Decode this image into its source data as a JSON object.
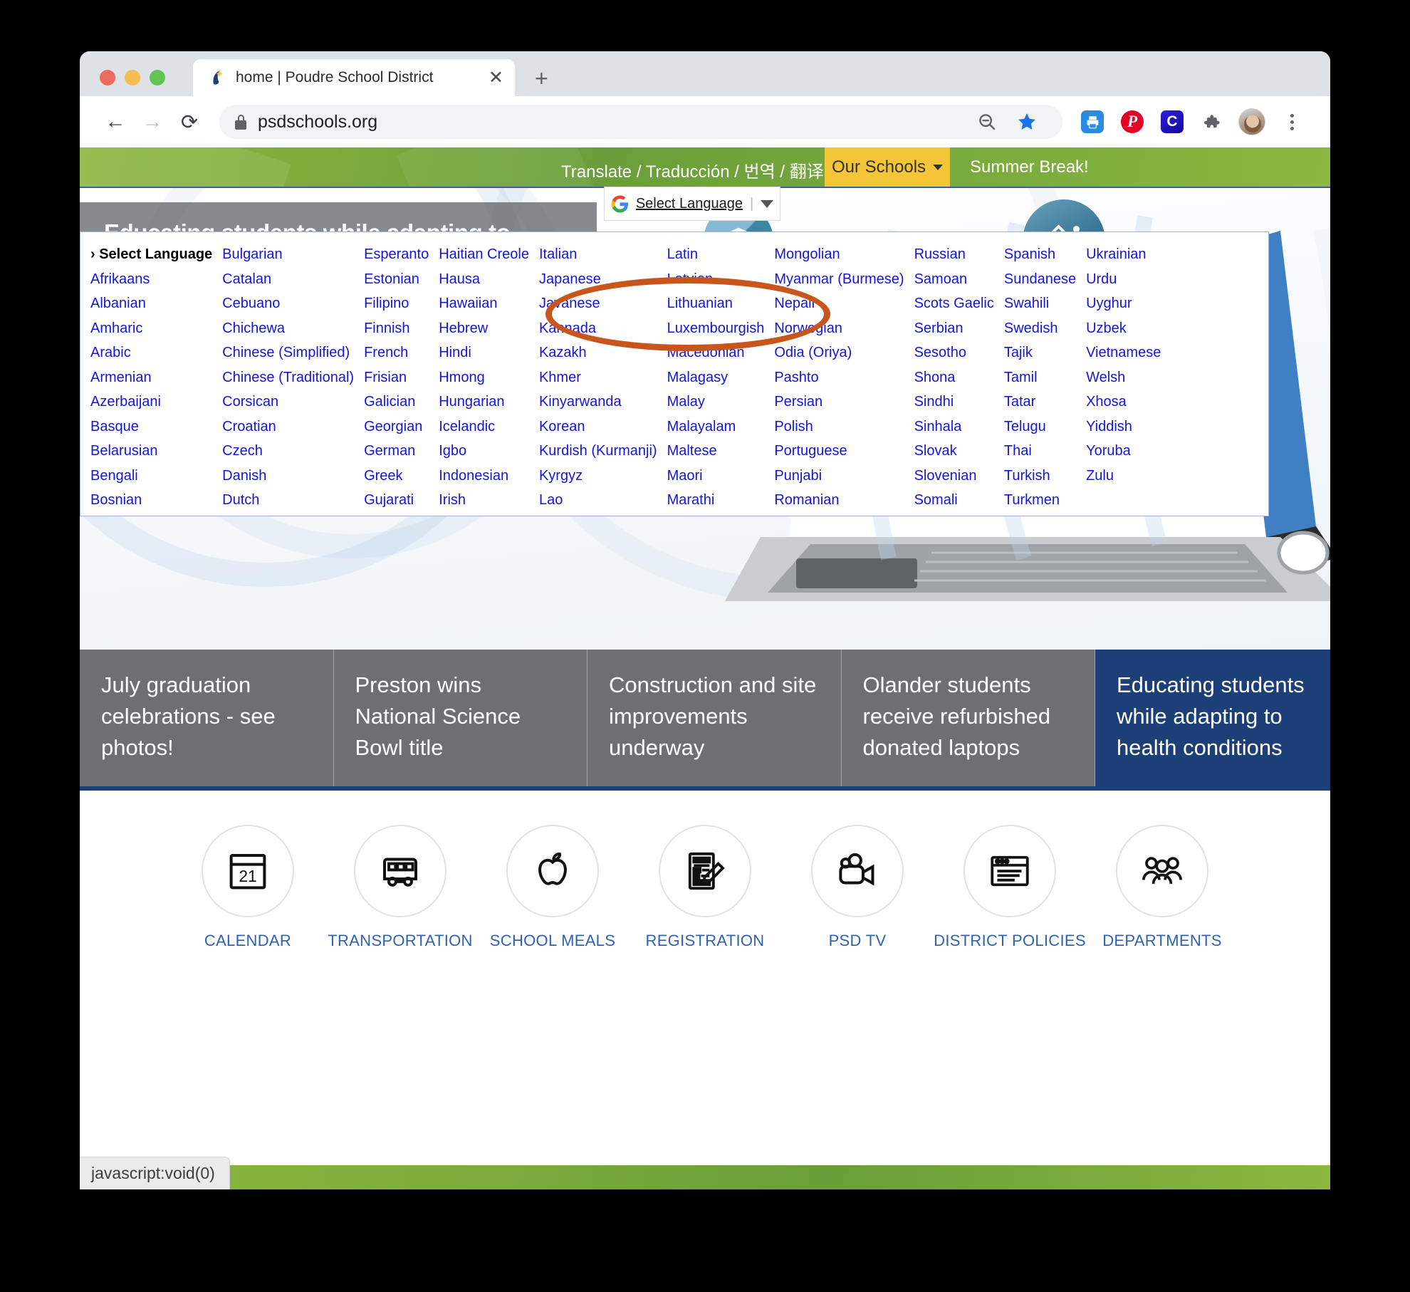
{
  "browser": {
    "tab": {
      "title": "home | Poudre School District",
      "favicon": "psd-swoosh-icon",
      "close": "✕"
    },
    "new_tab_label": "+",
    "nav": {
      "back": "←",
      "forward": "→",
      "reload": "⟳"
    },
    "omnibox": {
      "url": "psdschools.org",
      "lock": "lock-icon"
    },
    "toolbar_icons": [
      {
        "name": "zoom-out-icon",
        "glyph": "⊖",
        "color": "#5f6368"
      },
      {
        "name": "bookmark-star-icon",
        "glyph": "★",
        "color": "#1a73e8"
      },
      {
        "name": "print-extension-icon",
        "glyph": "⎙",
        "color": "#ffffff",
        "bg": "#2a8ce0"
      },
      {
        "name": "pinterest-extension-icon",
        "glyph": "𝑃",
        "color": "#ffffff",
        "bg": "#e60023"
      },
      {
        "name": "clarity-extension-icon",
        "glyph": "C",
        "color": "#ffffff",
        "bg": "#2319c8"
      },
      {
        "name": "extensions-puzzle-icon",
        "glyph": "🧩",
        "color": "#5f6368"
      },
      {
        "name": "profile-avatar",
        "glyph": "",
        "color": ""
      },
      {
        "name": "chrome-menu-kebab-icon",
        "glyph": "⋮",
        "color": "#5f6368"
      }
    ],
    "status_text": "javascript:void(0)"
  },
  "site": {
    "utility_bar": {
      "translate_label": "Translate / Traducción / 번역 / 翻译 / ترجمة",
      "our_schools": "Our Schools",
      "summer_break": "Summer Break!"
    },
    "select_language": {
      "label": "Select Language",
      "google_logo": "google-g-icon",
      "caret": "▼"
    },
    "language_panel": {
      "header": "› Select Language",
      "columns": [
        [
          "Afrikaans",
          "Albanian",
          "Amharic",
          "Arabic",
          "Armenian",
          "Azerbaijani",
          "Basque",
          "Belarusian",
          "Bengali",
          "Bosnian"
        ],
        [
          "Bulgarian",
          "Catalan",
          "Cebuano",
          "Chichewa",
          "Chinese (Simplified)",
          "Chinese (Traditional)",
          "Corsican",
          "Croatian",
          "Czech",
          "Danish",
          "Dutch"
        ],
        [
          "Esperanto",
          "Estonian",
          "Filipino",
          "Finnish",
          "French",
          "Frisian",
          "Galician",
          "Georgian",
          "German",
          "Greek",
          "Gujarati"
        ],
        [
          "Haitian Creole",
          "Hausa",
          "Hawaiian",
          "Hebrew",
          "Hindi",
          "Hmong",
          "Hungarian",
          "Icelandic",
          "Igbo",
          "Indonesian",
          "Irish"
        ],
        [
          "Italian",
          "Japanese",
          "Javanese",
          "Kannada",
          "Kazakh",
          "Khmer",
          "Kinyarwanda",
          "Korean",
          "Kurdish (Kurmanji)",
          "Kyrgyz",
          "Lao"
        ],
        [
          "Latin",
          "Latvian",
          "Lithuanian",
          "Luxembourgish",
          "Macedonian",
          "Malagasy",
          "Malay",
          "Malayalam",
          "Maltese",
          "Maori",
          "Marathi"
        ],
        [
          "Mongolian",
          "Myanmar (Burmese)",
          "Nepali",
          "Norwegian",
          "Odia (Oriya)",
          "Pashto",
          "Persian",
          "Polish",
          "Portuguese",
          "Punjabi",
          "Romanian"
        ],
        [
          "Russian",
          "Samoan",
          "Scots Gaelic",
          "Serbian",
          "Sesotho",
          "Shona",
          "Sindhi",
          "Sinhala",
          "Slovak",
          "Slovenian",
          "Somali"
        ],
        [
          "Spanish",
          "Sundanese",
          "Swahili",
          "Swedish",
          "Tajik",
          "Tamil",
          "Tatar",
          "Telugu",
          "Thai",
          "Turkish",
          "Turkmen"
        ],
        [
          "Ukrainian",
          "Urdu",
          "Uyghur",
          "Uzbek",
          "Vietnamese",
          "Welsh",
          "Xhosa",
          "Yiddish",
          "Yoruba",
          "Zulu"
        ]
      ]
    },
    "hero": {
      "headline": "Educating students while adapting to health conditions",
      "bubble_icons": [
        "graduation-cap-icon",
        "globe-icon",
        "microscope-icon",
        "flask-icon",
        "palette-icon"
      ]
    },
    "news_cards": [
      {
        "title": "July graduation celebrations - see photos!",
        "active": false
      },
      {
        "title": "Preston wins National Science Bowl title",
        "active": false
      },
      {
        "title": "Construction and site improvements underway",
        "active": false
      },
      {
        "title": "Olander students receive refurbished donated laptops",
        "active": false
      },
      {
        "title": "Educating students while adapting to health conditions",
        "active": true
      }
    ],
    "quick_links": [
      {
        "label": "CALENDAR",
        "icon": "calendar-icon",
        "day": "21"
      },
      {
        "label": "TRANSPORTATION",
        "icon": "bus-icon"
      },
      {
        "label": "SCHOOL MEALS",
        "icon": "apple-icon"
      },
      {
        "label": "REGISTRATION",
        "icon": "document-pencil-icon"
      },
      {
        "label": "PSD TV",
        "icon": "video-camera-icon"
      },
      {
        "label": "DISTRICT POLICIES",
        "icon": "browser-window-icon"
      },
      {
        "label": "DEPARTMENTS",
        "icon": "people-group-icon"
      }
    ]
  },
  "annotation": {
    "shape": "ellipse-highlight",
    "color": "#c8551c"
  }
}
